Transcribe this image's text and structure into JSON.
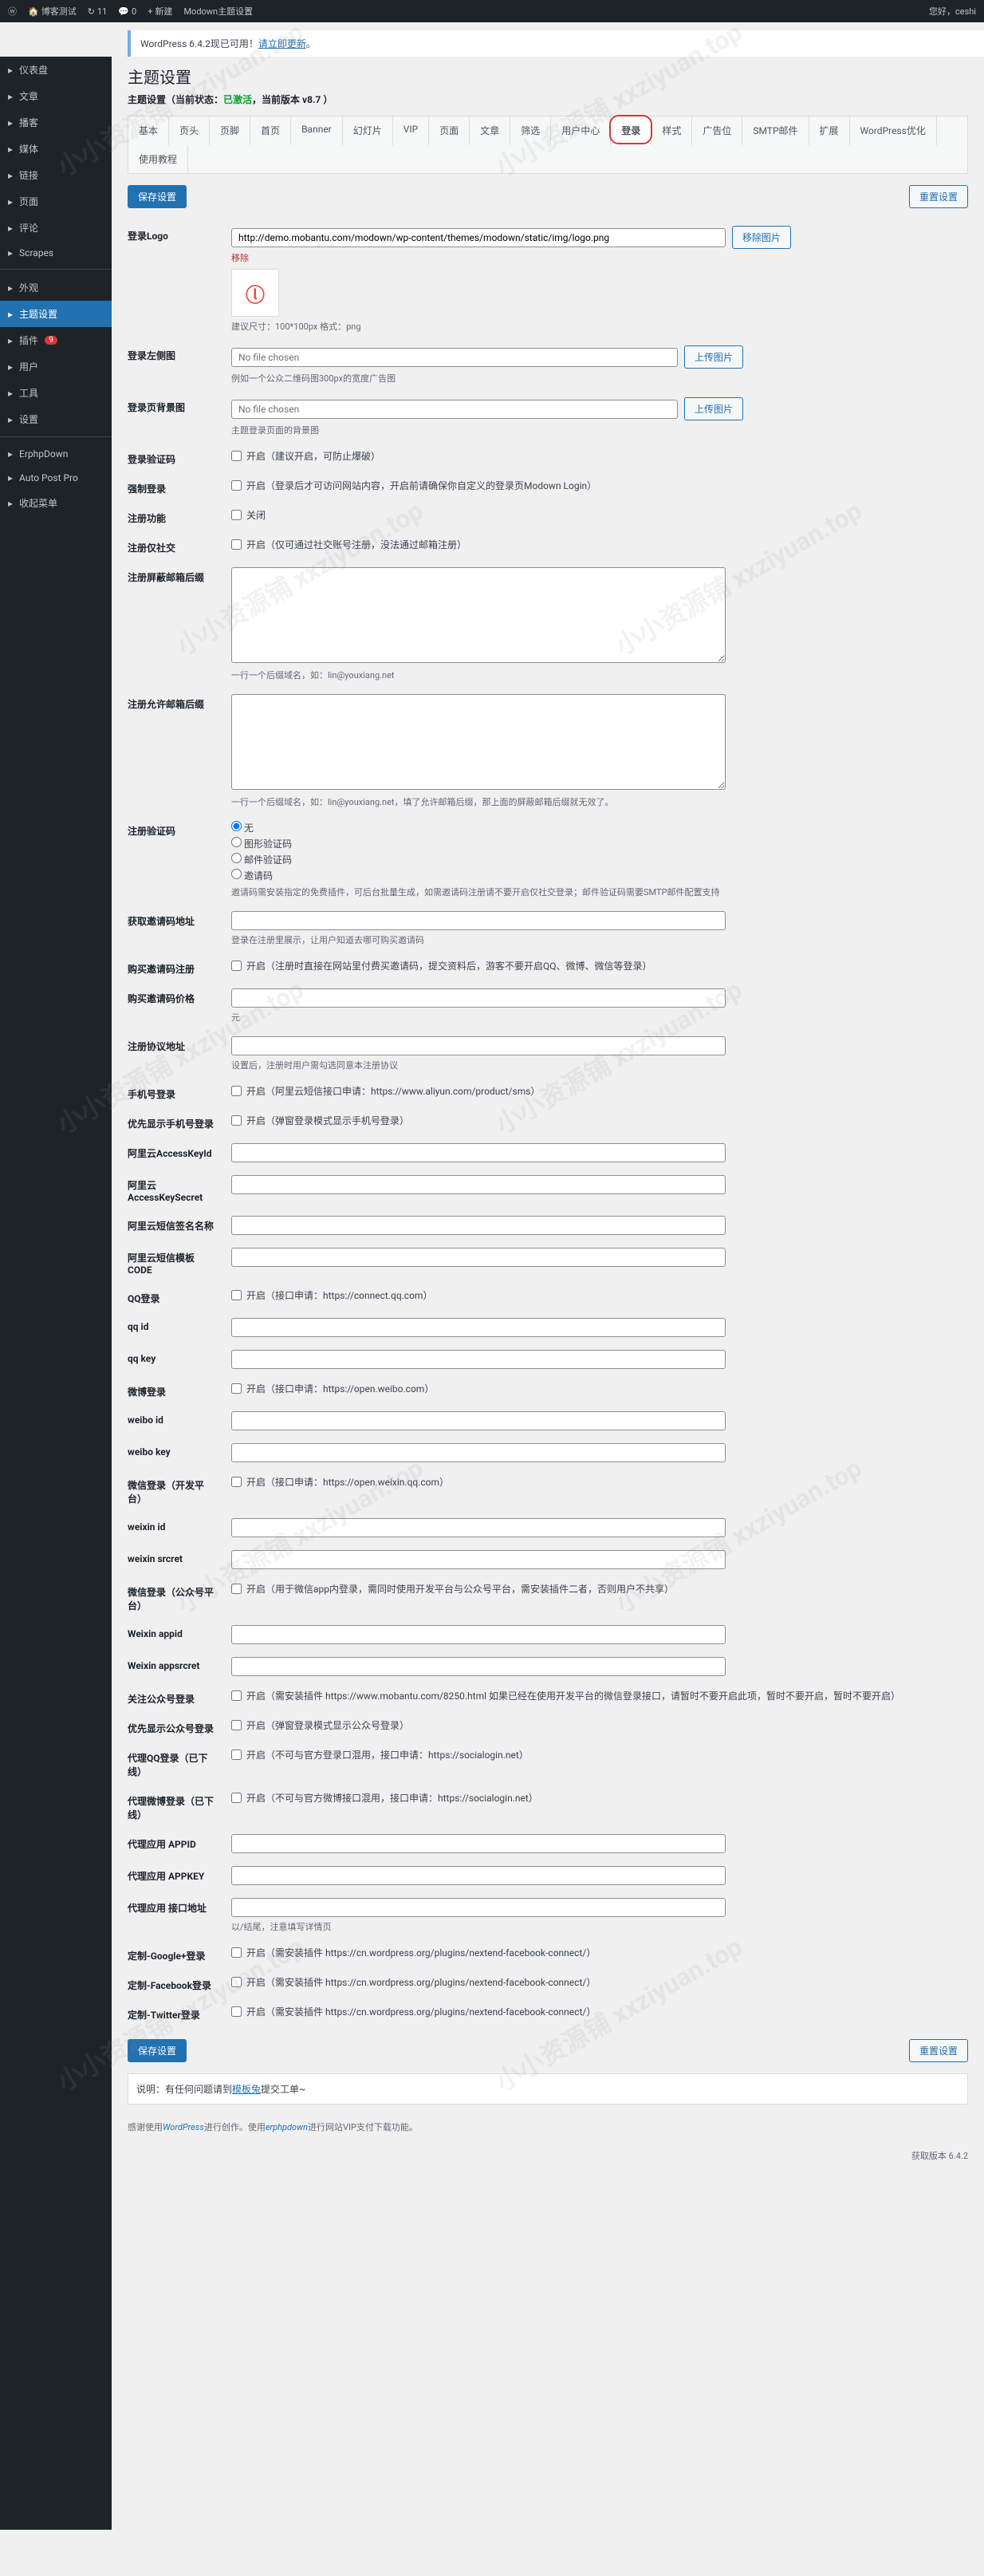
{
  "update_notice": {
    "pre": "WordPress 6.4.2现已可用！",
    "link": "请立即更新"
  },
  "adminbar": {
    "site": "博客测试",
    "updates": "11",
    "comments": "0",
    "new": "新建",
    "settings": "Modown主题设置",
    "greeting": "您好，ceshi"
  },
  "menu": [
    {
      "label": "仪表盘",
      "icon": "dash"
    },
    {
      "label": "文章",
      "icon": "post"
    },
    {
      "label": "播客",
      "icon": "mic"
    },
    {
      "label": "媒体",
      "icon": "media"
    },
    {
      "label": "链接",
      "icon": "link"
    },
    {
      "label": "页面",
      "icon": "page"
    },
    {
      "label": "评论",
      "icon": "comment"
    },
    {
      "label": "Scrapes",
      "icon": "scrape"
    },
    {
      "label": "外观",
      "icon": "appearance"
    },
    {
      "label": "主题设置",
      "icon": "theme",
      "active": true
    },
    {
      "label": "插件",
      "icon": "plugin",
      "badge": "9"
    },
    {
      "label": "用户",
      "icon": "user"
    },
    {
      "label": "工具",
      "icon": "tool"
    },
    {
      "label": "设置",
      "icon": "setting"
    },
    {
      "label": "ErphpDown",
      "icon": "erphp"
    },
    {
      "label": "Auto Post Pro",
      "icon": "auto"
    },
    {
      "label": "收起菜单",
      "icon": "collapse"
    }
  ],
  "page": {
    "title": "主题设置",
    "subtitle_pre": "主题设置（当前状态：",
    "subtitle_status": "已激活",
    "subtitle_post": "，当前版本 v8.7 ）"
  },
  "tabs": [
    "基本",
    "页头",
    "页脚",
    "首页",
    "Banner",
    "幻灯片",
    "VIP",
    "页面",
    "文章",
    "筛选",
    "用户中心",
    "登录",
    "样式",
    "广告位",
    "SMTP邮件",
    "扩展",
    "WordPress优化",
    "使用教程"
  ],
  "active_tab": "登录",
  "buttons": {
    "save": "保存设置",
    "reset": "重置设置"
  },
  "fields": {
    "logo": {
      "label": "登录Logo",
      "value": "http://demo.mobantu.com/modown/wp-content/themes/modown/static/img/logo.png",
      "btn": "移除图片",
      "remove": "移除",
      "hint": "建议尺寸：100*100px 格式：png"
    },
    "leftimg": {
      "label": "登录左侧图",
      "placeholder": "No file chosen",
      "btn": "上传图片",
      "hint": "例如一个公众二维码图300px的宽度广告图"
    },
    "bgimg": {
      "label": "登录页背景图",
      "placeholder": "No file chosen",
      "btn": "上传图片",
      "hint": "主题登录页面的背景图"
    },
    "captcha": {
      "label": "登录验证码",
      "cb": "开启（建议开启，可防止爆破）"
    },
    "force": {
      "label": "强制登录",
      "cb": "开启（登录后才可访问网站内容，开启前请确保你自定义的登录页Modown Login）"
    },
    "regfunc": {
      "label": "注册功能",
      "cb": "关闭"
    },
    "regsocial": {
      "label": "注册仅社交",
      "cb": "开启（仅可通过社交账号注册，没法通过邮箱注册）"
    },
    "blockemail": {
      "label": "注册屏蔽邮箱后缀",
      "hint": "一行一个后缀域名，如：lin@youxiang.net"
    },
    "allowemail": {
      "label": "注册允许邮箱后缀",
      "hint": "一行一个后缀域名，如：lin@youxiang.net，填了允许邮箱后缀，那上面的屏蔽邮箱后缀就无效了。"
    },
    "regcaptcha": {
      "label": "注册验证码",
      "options": [
        "无",
        "图形验证码",
        "邮件验证码",
        "邀请码"
      ],
      "hint": "邀请码需安装指定的免费插件，可后台批量生成，如需邀请码注册请不要开启仅社交登录；邮件验证码需要SMTP邮件配置支持"
    },
    "inviteurl": {
      "label": "获取邀请码地址",
      "hint": "登录在注册里展示，让用户知道去哪可购买邀请码"
    },
    "buyinvite": {
      "label": "购买邀请码注册",
      "cb": "开启（注册时直接在网站里付费买邀请码，提交资料后，游客不要开启QQ、微博、微信等登录）"
    },
    "inviteprice": {
      "label": "购买邀请码价格",
      "hint": "元"
    },
    "agreeurl": {
      "label": "注册协议地址",
      "hint": "设置后，注册时用户需勾选同意本注册协议"
    },
    "phonelogin": {
      "label": "手机号登录",
      "cb": "开启（阿里云短信接口申请：https://www.aliyun.com/product/sms）"
    },
    "phonefirst": {
      "label": "优先显示手机号登录",
      "cb": "开启（弹窗登录模式显示手机号登录）"
    },
    "akid": {
      "label": "阿里云AccessKeyId"
    },
    "aksecret": {
      "label": "阿里云AccessKeySecret"
    },
    "smssign": {
      "label": "阿里云短信签名名称"
    },
    "smstpl": {
      "label": "阿里云短信模板CODE"
    },
    "qqlogin": {
      "label": "QQ登录",
      "cb": "开启（接口申请：https://connect.qq.com）"
    },
    "qqid": {
      "label": "qq id"
    },
    "qqkey": {
      "label": "qq key"
    },
    "wblogin": {
      "label": "微博登录",
      "cb": "开启（接口申请：https://open.weibo.com）"
    },
    "wbid": {
      "label": "weibo id"
    },
    "wbkey": {
      "label": "weibo key"
    },
    "wxopen": {
      "label": "微信登录（开发平台）",
      "cb": "开启（接口申请：https://open.weixin.qq.com）"
    },
    "wxid": {
      "label": "weixin id"
    },
    "wxsecret": {
      "label": "weixin srcret"
    },
    "wxmp": {
      "label": "微信登录（公众号平台）",
      "cb": "开启（用于微信app内登录，需同时使用开发平台与公众号平台，需安装插件二者，否则用户不共享）"
    },
    "wxappid": {
      "label": "Weixin appid"
    },
    "wxappsecret": {
      "label": "Weixin appsrcret"
    },
    "followmp": {
      "label": "关注公众号登录",
      "cb": "开启（需安装插件 https://www.mobantu.com/8250.html 如果已经在使用开发平台的微信登录接口，请暂时不要开启此项，暂时不要开启，暂时不要开启）"
    },
    "mpfirst": {
      "label": "优先显示公众号登录",
      "cb": "开启（弹窗登录模式显示公众号登录）"
    },
    "proxyqq": {
      "label": "代理QQ登录（已下线）",
      "cb": "开启（不可与官方登录口混用，接口申请：https://socialogin.net）"
    },
    "proxywb": {
      "label": "代理微博登录（已下线）",
      "cb": "开启（不可与官方微博接口混用，接口申请：https://socialogin.net）"
    },
    "proxyappid": {
      "label": "代理应用 APPID"
    },
    "proxyappkey": {
      "label": "代理应用 APPKEY"
    },
    "proxyapi": {
      "label": "代理应用 接口地址",
      "hint": "以/结尾，注意填写详情页"
    },
    "google": {
      "label": "定制-Google+登录",
      "cb": "开启（需安装插件 https://cn.wordpress.org/plugins/nextend-facebook-connect/）"
    },
    "facebook": {
      "label": "定制-Facebook登录",
      "cb": "开启（需安装插件 https://cn.wordpress.org/plugins/nextend-facebook-connect/）"
    },
    "twitter": {
      "label": "定制-Twitter登录",
      "cb": "开启（需安装插件 https://cn.wordpress.org/plugins/nextend-facebook-connect/）"
    }
  },
  "footer_note": {
    "pre": "说明：有任何问题请到",
    "link": "模板兔",
    "post": "提交工单~"
  },
  "bottom": {
    "text": "感谢使用",
    "link1": "WordPress",
    "mid": "进行创作。使用",
    "link2": "erphpdown",
    "end": "进行网站VIP支付下载功能。",
    "version": "获取版本 6.4.2"
  },
  "watermark": "小小资源铺 xxziyuan.top"
}
